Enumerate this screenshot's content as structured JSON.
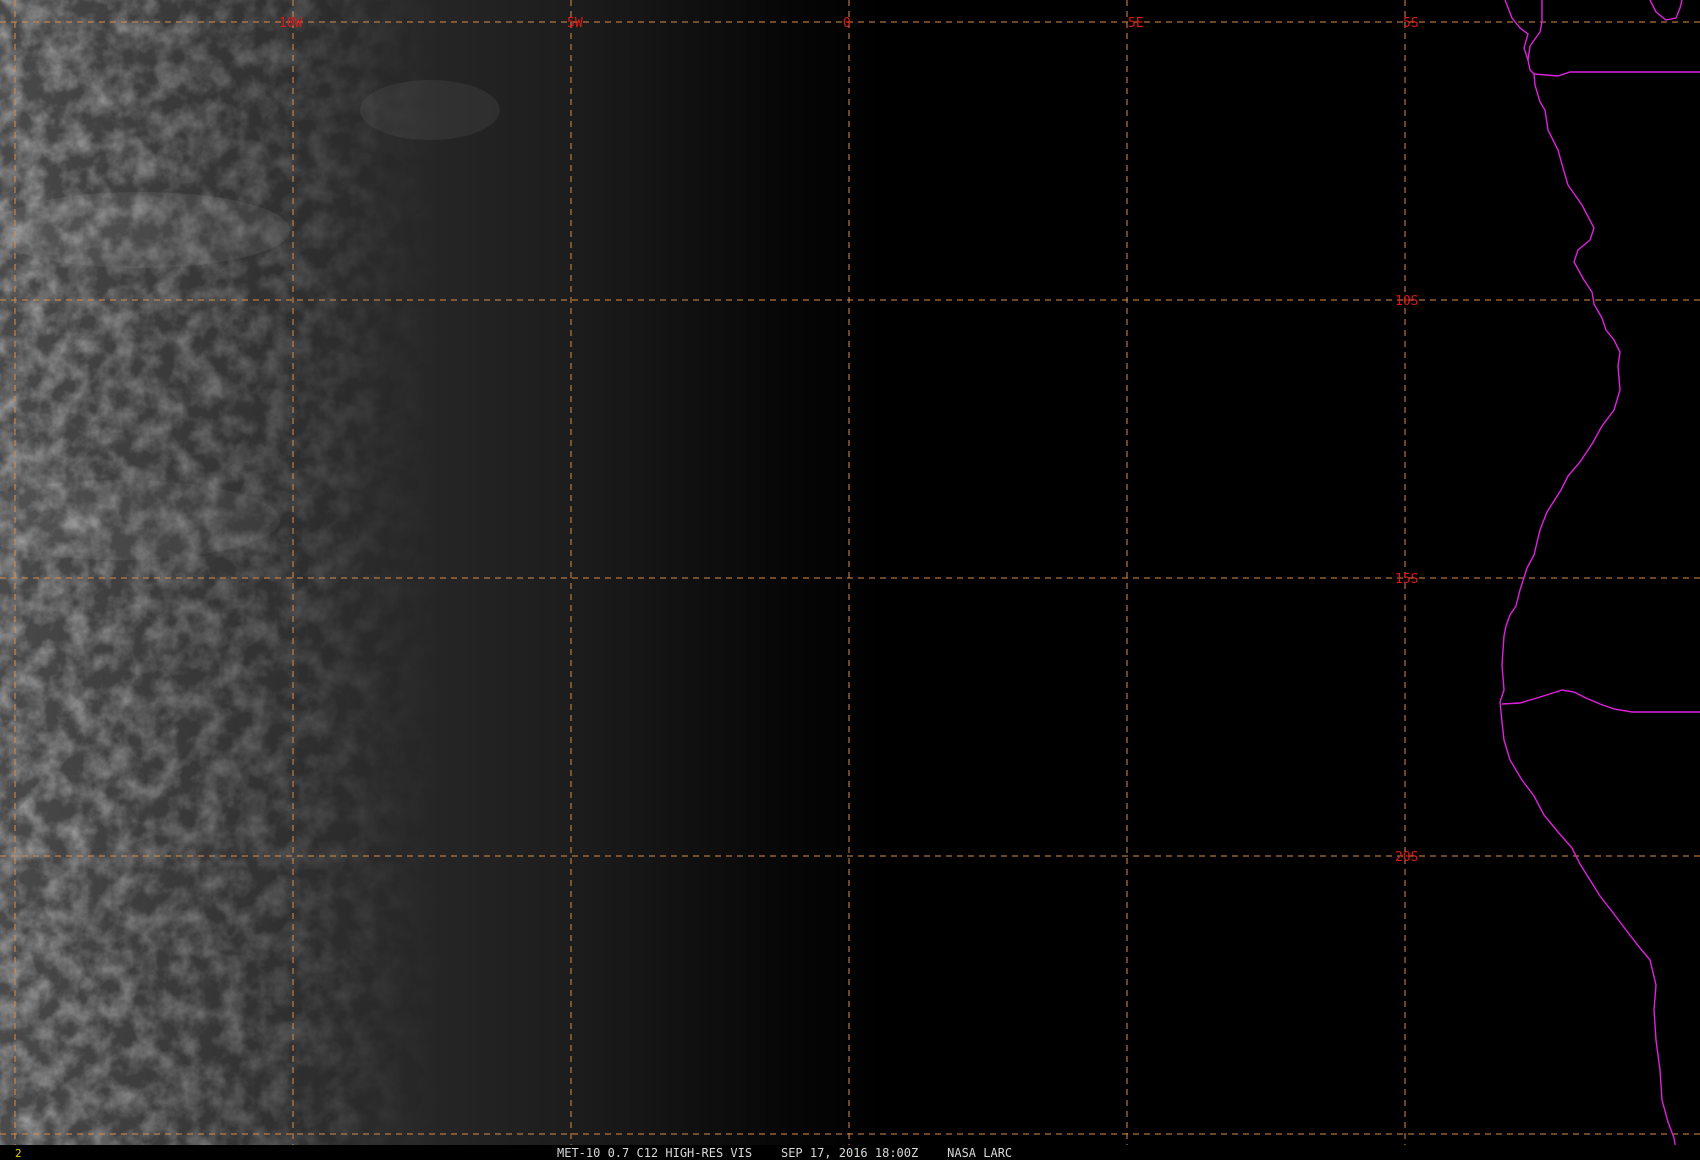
{
  "map": {
    "longitude_labels": [
      "10W",
      "5W",
      "0",
      "5E",
      "5S"
    ],
    "latitude_labels": [
      "10S",
      "15S",
      "20S"
    ],
    "colors": {
      "grid": "#d88c4a",
      "labels": "#e01818",
      "coastline": "#e020e0",
      "background": "#000000",
      "footer_text": "#d8d8d8",
      "frame_number": "#e8d000"
    }
  },
  "footer": {
    "frame_number": "2",
    "caption": "MET-10 0.7 C12 HIGH-RES VIS    SEP 17, 2016 18:00Z    NASA LARC"
  }
}
